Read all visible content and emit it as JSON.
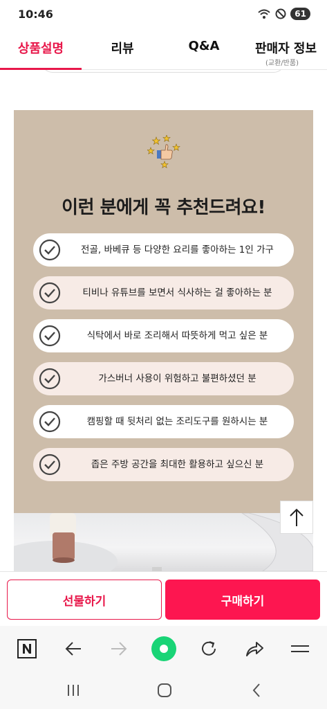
{
  "status_bar": {
    "time": "10:46",
    "battery": "61",
    "icons": [
      "wifi-icon",
      "do-not-disturb-icon"
    ]
  },
  "tabs": [
    {
      "label": "상품설명",
      "active": true
    },
    {
      "label": "리뷰",
      "active": false
    },
    {
      "label": "Q&A",
      "active": false
    },
    {
      "label": "판매자 정보",
      "sub": "(교환/반품)",
      "active": false
    }
  ],
  "content": {
    "heading": "이런 분에게 꼭 추천드려요!",
    "recommendations": [
      "전골, 바베큐 등 다양한 요리를 좋아하는 1인 가구",
      "티비나 유튜브를 보면서 식사하는 걸 좋아하는 분",
      "식탁에서 바로 조리해서 따뜻하게 먹고 싶은 분",
      "가스버너 사용이 위험하고 불편하셨던 분",
      "캠핑할 때 뒷처리 없는 조리도구를 원하시는 분",
      "좁은 주방 공간을 최대한 활용하고 싶으신 분"
    ]
  },
  "actions": {
    "gift": "선물하기",
    "buy": "구매하기"
  },
  "colors": {
    "accent": "#e8174a",
    "buy_button": "#fd1650",
    "panel_bg": "#cdbdaa",
    "row_white": "#ffffff",
    "row_pink": "#f7ebe6"
  }
}
